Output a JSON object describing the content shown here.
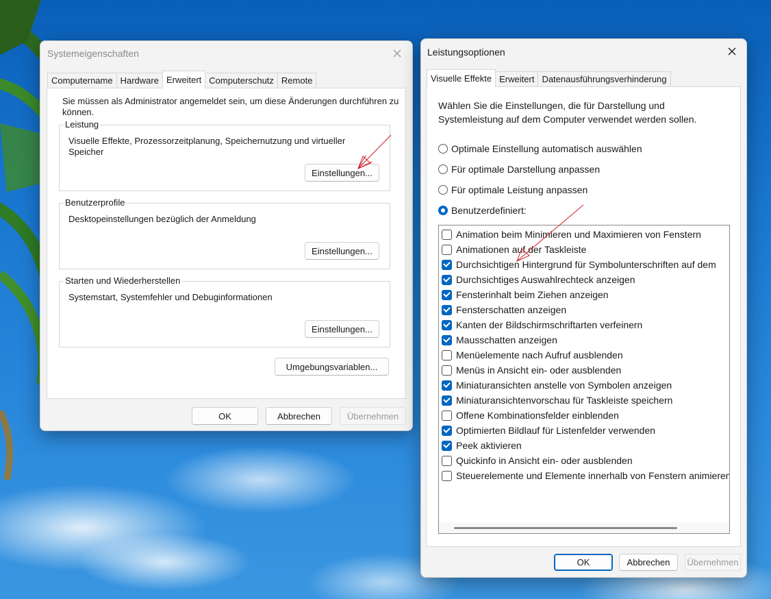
{
  "colors": {
    "accent": "#0067c0",
    "annotation_arrow": "#d0202a"
  },
  "sys": {
    "title": "Systemeigenschaften",
    "tabs": [
      "Computername",
      "Hardware",
      "Erweitert",
      "Computerschutz",
      "Remote"
    ],
    "active_tab": "Erweitert",
    "admin_note": "Sie müssen als Administrator angemeldet sein, um diese Änderungen durchführen zu können.",
    "groups": [
      {
        "label": "Leistung",
        "text": "Visuelle Effekte, Prozessorzeitplanung, Speichernutzung und virtueller Speicher",
        "button": "Einstellungen..."
      },
      {
        "label": "Benutzerprofile",
        "text": "Desktopeinstellungen bezüglich der Anmeldung",
        "button": "Einstellungen..."
      },
      {
        "label": "Starten und Wiederherstellen",
        "text": "Systemstart, Systemfehler und Debuginformationen",
        "button": "Einstellungen..."
      }
    ],
    "env_button": "Umgebungsvariablen...",
    "ok": "OK",
    "cancel": "Abbrechen",
    "apply": "Übernehmen"
  },
  "perf": {
    "title": "Leistungsoptionen",
    "tabs": [
      "Visuelle Effekte",
      "Erweitert",
      "Datenausführungsverhinderung"
    ],
    "active_tab": "Visuelle Effekte",
    "description": "Wählen Sie die Einstellungen, die für Darstellung und Systemleistung auf dem Computer verwendet werden sollen.",
    "radios": [
      {
        "label": "Optimale Einstellung automatisch auswählen",
        "selected": false
      },
      {
        "label": "Für optimale Darstellung anpassen",
        "selected": false
      },
      {
        "label": "Für optimale Leistung anpassen",
        "selected": false
      },
      {
        "label": "Benutzerdefiniert:",
        "selected": true
      }
    ],
    "effects": [
      {
        "label": "Animation beim Minimieren und Maximieren von Fenstern",
        "checked": false
      },
      {
        "label": "Animationen auf der Taskleiste",
        "checked": false
      },
      {
        "label": "Durchsichtigen Hintergrund für Symbolunterschriften auf dem",
        "checked": true
      },
      {
        "label": "Durchsichtiges Auswahlrechteck anzeigen",
        "checked": true
      },
      {
        "label": "Fensterinhalt beim Ziehen anzeigen",
        "checked": true
      },
      {
        "label": "Fensterschatten anzeigen",
        "checked": true
      },
      {
        "label": "Kanten der Bildschirmschriftarten verfeinern",
        "checked": true
      },
      {
        "label": "Mausschatten anzeigen",
        "checked": true
      },
      {
        "label": "Menüelemente nach Aufruf ausblenden",
        "checked": false
      },
      {
        "label": "Menüs in Ansicht ein- oder ausblenden",
        "checked": false
      },
      {
        "label": "Miniaturansichten anstelle von Symbolen anzeigen",
        "checked": true
      },
      {
        "label": "Miniaturansichtenvorschau für Taskleiste speichern",
        "checked": true
      },
      {
        "label": "Offene Kombinationsfelder einblenden",
        "checked": false
      },
      {
        "label": "Optimierten Bildlauf für Listenfelder verwenden",
        "checked": true
      },
      {
        "label": "Peek aktivieren",
        "checked": true
      },
      {
        "label": "Quickinfo in Ansicht ein- oder ausblenden",
        "checked": false
      },
      {
        "label": "Steuerelemente und Elemente innerhalb von Fenstern animieren",
        "checked": false
      }
    ],
    "ok": "OK",
    "cancel": "Abbrechen",
    "apply": "Übernehmen"
  }
}
